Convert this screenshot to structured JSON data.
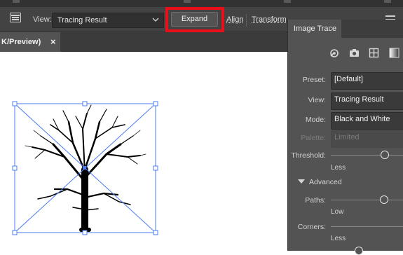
{
  "control_bar": {
    "view_label": "View:",
    "view_value": "Tracing Result",
    "expand_label": "Expand",
    "align_label": "Align",
    "transform_label": "Transform"
  },
  "document_tab": {
    "title": "K/Preview)",
    "close_glyph": "×"
  },
  "image_trace_panel": {
    "tab_title": "Image Trace",
    "preset": {
      "label": "Preset:",
      "value": "[Default]"
    },
    "view": {
      "label": "View:",
      "value": "Tracing Result"
    },
    "mode": {
      "label": "Mode:",
      "value": "Black and White"
    },
    "palette": {
      "label": "Palette:",
      "value": "Limited"
    },
    "threshold": {
      "label": "Threshold:",
      "caption": "Less"
    },
    "advanced_label": "Advanced",
    "paths": {
      "label": "Paths:",
      "caption": "Low"
    },
    "corners": {
      "label": "Corners:",
      "caption": "Less"
    }
  },
  "colors": {
    "highlight": "#e8111b",
    "selection": "#4a7cf0",
    "panel_bg": "#535353",
    "toolbar_bg": "#434343"
  },
  "icons": [
    "panel-menu-icon",
    "auto-color-icon",
    "camera-icon",
    "grid-icon",
    "gradient-icon",
    "close-icon",
    "chevron-down-icon"
  ]
}
